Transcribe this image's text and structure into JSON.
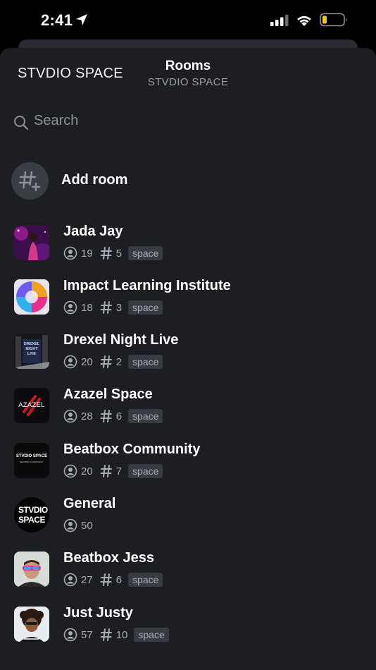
{
  "status_bar": {
    "time": "2:41"
  },
  "header": {
    "space_name": "STVDIO SPACE",
    "title": "Rooms",
    "subtitle": "STVDIO SPACE"
  },
  "search": {
    "placeholder": "Search"
  },
  "add_room": {
    "label": "Add room"
  },
  "rooms": [
    {
      "name": "Jada Jay",
      "members": "19",
      "channels": "5",
      "tag": "space"
    },
    {
      "name": "Impact Learning Institute",
      "members": "18",
      "channels": "3",
      "tag": "space"
    },
    {
      "name": "Drexel Night Live",
      "members": "20",
      "channels": "2",
      "tag": "space",
      "thumb_text": "DREXEL NIGHT LIVE"
    },
    {
      "name": "Azazel Space",
      "members": "28",
      "channels": "6",
      "tag": "space",
      "thumb_text": "AZAZEL"
    },
    {
      "name": "Beatbox Community",
      "members": "20",
      "channels": "7",
      "tag": "space",
      "thumb_text": "STVDIO SPACE",
      "thumb_subtext": "BEATBOX COMMUNITY"
    },
    {
      "name": "General",
      "members": "50",
      "thumb_text": "STVDIO SPACE"
    },
    {
      "name": "Beatbox Jess",
      "members": "27",
      "channels": "6",
      "tag": "space"
    },
    {
      "name": "Just Justy",
      "members": "57",
      "channels": "10",
      "tag": "space"
    }
  ],
  "colors": {
    "background": "#1c1e22",
    "tag_bg": "#383b42",
    "muted": "#a8acb4",
    "battery_low": "#f5c518"
  }
}
